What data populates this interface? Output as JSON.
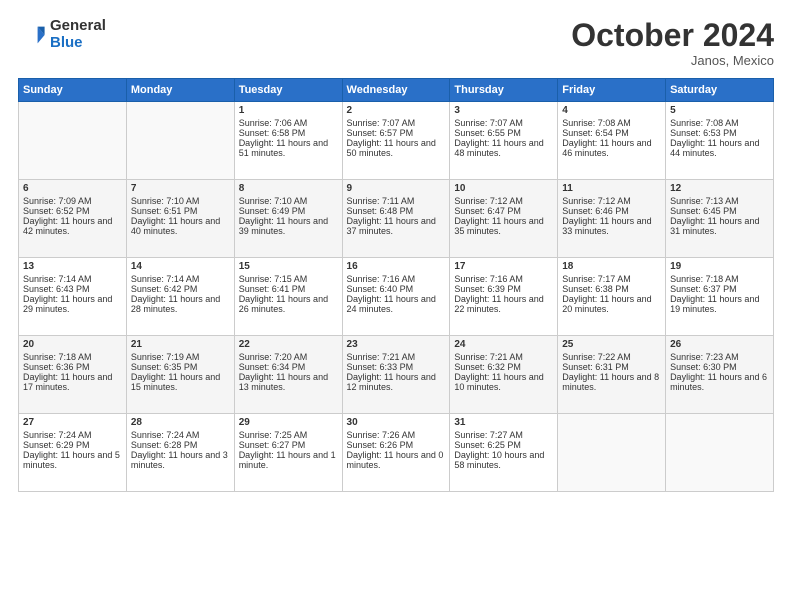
{
  "logo": {
    "general": "General",
    "blue": "Blue"
  },
  "header": {
    "month": "October 2024",
    "location": "Janos, Mexico"
  },
  "days_of_week": [
    "Sunday",
    "Monday",
    "Tuesday",
    "Wednesday",
    "Thursday",
    "Friday",
    "Saturday"
  ],
  "weeks": [
    [
      {
        "day": "",
        "sunrise": "",
        "sunset": "",
        "daylight": ""
      },
      {
        "day": "",
        "sunrise": "",
        "sunset": "",
        "daylight": ""
      },
      {
        "day": "1",
        "sunrise": "Sunrise: 7:06 AM",
        "sunset": "Sunset: 6:58 PM",
        "daylight": "Daylight: 11 hours and 51 minutes."
      },
      {
        "day": "2",
        "sunrise": "Sunrise: 7:07 AM",
        "sunset": "Sunset: 6:57 PM",
        "daylight": "Daylight: 11 hours and 50 minutes."
      },
      {
        "day": "3",
        "sunrise": "Sunrise: 7:07 AM",
        "sunset": "Sunset: 6:55 PM",
        "daylight": "Daylight: 11 hours and 48 minutes."
      },
      {
        "day": "4",
        "sunrise": "Sunrise: 7:08 AM",
        "sunset": "Sunset: 6:54 PM",
        "daylight": "Daylight: 11 hours and 46 minutes."
      },
      {
        "day": "5",
        "sunrise": "Sunrise: 7:08 AM",
        "sunset": "Sunset: 6:53 PM",
        "daylight": "Daylight: 11 hours and 44 minutes."
      }
    ],
    [
      {
        "day": "6",
        "sunrise": "Sunrise: 7:09 AM",
        "sunset": "Sunset: 6:52 PM",
        "daylight": "Daylight: 11 hours and 42 minutes."
      },
      {
        "day": "7",
        "sunrise": "Sunrise: 7:10 AM",
        "sunset": "Sunset: 6:51 PM",
        "daylight": "Daylight: 11 hours and 40 minutes."
      },
      {
        "day": "8",
        "sunrise": "Sunrise: 7:10 AM",
        "sunset": "Sunset: 6:49 PM",
        "daylight": "Daylight: 11 hours and 39 minutes."
      },
      {
        "day": "9",
        "sunrise": "Sunrise: 7:11 AM",
        "sunset": "Sunset: 6:48 PM",
        "daylight": "Daylight: 11 hours and 37 minutes."
      },
      {
        "day": "10",
        "sunrise": "Sunrise: 7:12 AM",
        "sunset": "Sunset: 6:47 PM",
        "daylight": "Daylight: 11 hours and 35 minutes."
      },
      {
        "day": "11",
        "sunrise": "Sunrise: 7:12 AM",
        "sunset": "Sunset: 6:46 PM",
        "daylight": "Daylight: 11 hours and 33 minutes."
      },
      {
        "day": "12",
        "sunrise": "Sunrise: 7:13 AM",
        "sunset": "Sunset: 6:45 PM",
        "daylight": "Daylight: 11 hours and 31 minutes."
      }
    ],
    [
      {
        "day": "13",
        "sunrise": "Sunrise: 7:14 AM",
        "sunset": "Sunset: 6:43 PM",
        "daylight": "Daylight: 11 hours and 29 minutes."
      },
      {
        "day": "14",
        "sunrise": "Sunrise: 7:14 AM",
        "sunset": "Sunset: 6:42 PM",
        "daylight": "Daylight: 11 hours and 28 minutes."
      },
      {
        "day": "15",
        "sunrise": "Sunrise: 7:15 AM",
        "sunset": "Sunset: 6:41 PM",
        "daylight": "Daylight: 11 hours and 26 minutes."
      },
      {
        "day": "16",
        "sunrise": "Sunrise: 7:16 AM",
        "sunset": "Sunset: 6:40 PM",
        "daylight": "Daylight: 11 hours and 24 minutes."
      },
      {
        "day": "17",
        "sunrise": "Sunrise: 7:16 AM",
        "sunset": "Sunset: 6:39 PM",
        "daylight": "Daylight: 11 hours and 22 minutes."
      },
      {
        "day": "18",
        "sunrise": "Sunrise: 7:17 AM",
        "sunset": "Sunset: 6:38 PM",
        "daylight": "Daylight: 11 hours and 20 minutes."
      },
      {
        "day": "19",
        "sunrise": "Sunrise: 7:18 AM",
        "sunset": "Sunset: 6:37 PM",
        "daylight": "Daylight: 11 hours and 19 minutes."
      }
    ],
    [
      {
        "day": "20",
        "sunrise": "Sunrise: 7:18 AM",
        "sunset": "Sunset: 6:36 PM",
        "daylight": "Daylight: 11 hours and 17 minutes."
      },
      {
        "day": "21",
        "sunrise": "Sunrise: 7:19 AM",
        "sunset": "Sunset: 6:35 PM",
        "daylight": "Daylight: 11 hours and 15 minutes."
      },
      {
        "day": "22",
        "sunrise": "Sunrise: 7:20 AM",
        "sunset": "Sunset: 6:34 PM",
        "daylight": "Daylight: 11 hours and 13 minutes."
      },
      {
        "day": "23",
        "sunrise": "Sunrise: 7:21 AM",
        "sunset": "Sunset: 6:33 PM",
        "daylight": "Daylight: 11 hours and 12 minutes."
      },
      {
        "day": "24",
        "sunrise": "Sunrise: 7:21 AM",
        "sunset": "Sunset: 6:32 PM",
        "daylight": "Daylight: 11 hours and 10 minutes."
      },
      {
        "day": "25",
        "sunrise": "Sunrise: 7:22 AM",
        "sunset": "Sunset: 6:31 PM",
        "daylight": "Daylight: 11 hours and 8 minutes."
      },
      {
        "day": "26",
        "sunrise": "Sunrise: 7:23 AM",
        "sunset": "Sunset: 6:30 PM",
        "daylight": "Daylight: 11 hours and 6 minutes."
      }
    ],
    [
      {
        "day": "27",
        "sunrise": "Sunrise: 7:24 AM",
        "sunset": "Sunset: 6:29 PM",
        "daylight": "Daylight: 11 hours and 5 minutes."
      },
      {
        "day": "28",
        "sunrise": "Sunrise: 7:24 AM",
        "sunset": "Sunset: 6:28 PM",
        "daylight": "Daylight: 11 hours and 3 minutes."
      },
      {
        "day": "29",
        "sunrise": "Sunrise: 7:25 AM",
        "sunset": "Sunset: 6:27 PM",
        "daylight": "Daylight: 11 hours and 1 minute."
      },
      {
        "day": "30",
        "sunrise": "Sunrise: 7:26 AM",
        "sunset": "Sunset: 6:26 PM",
        "daylight": "Daylight: 11 hours and 0 minutes."
      },
      {
        "day": "31",
        "sunrise": "Sunrise: 7:27 AM",
        "sunset": "Sunset: 6:25 PM",
        "daylight": "Daylight: 10 hours and 58 minutes."
      },
      {
        "day": "",
        "sunrise": "",
        "sunset": "",
        "daylight": ""
      },
      {
        "day": "",
        "sunrise": "",
        "sunset": "",
        "daylight": ""
      }
    ]
  ]
}
